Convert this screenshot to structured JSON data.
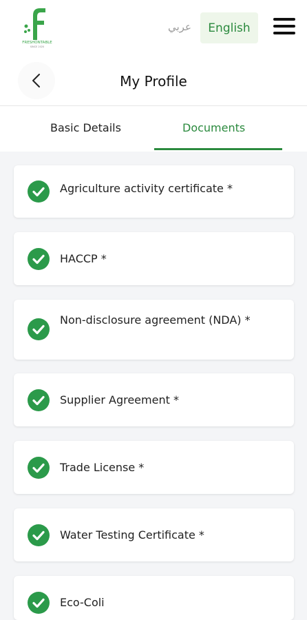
{
  "topbar": {
    "logo_text": "FRESHONTABLE",
    "logo_subtext": "SINCE 2020",
    "lang_arabic": "عربي",
    "lang_english": "English"
  },
  "header": {
    "title": "My Profile"
  },
  "tabs": [
    {
      "label": "Basic Details",
      "active": false
    },
    {
      "label": "Documents",
      "active": true
    }
  ],
  "documents": [
    {
      "label": "Agriculture activity certificate *",
      "status": "complete"
    },
    {
      "label": "HACCP *",
      "status": "complete"
    },
    {
      "label": "Non-disclosure agreement (NDA) *",
      "status": "complete"
    },
    {
      "label": "Supplier Agreement *",
      "status": "complete"
    },
    {
      "label": "Trade License *",
      "status": "complete"
    },
    {
      "label": "Water Testing Certificate *",
      "status": "complete"
    },
    {
      "label": "Eco-Coli",
      "status": "complete"
    }
  ],
  "colors": {
    "accent": "#2b8a3e",
    "check": "#2b9a4a",
    "lang_bg": "#eef6ea"
  }
}
